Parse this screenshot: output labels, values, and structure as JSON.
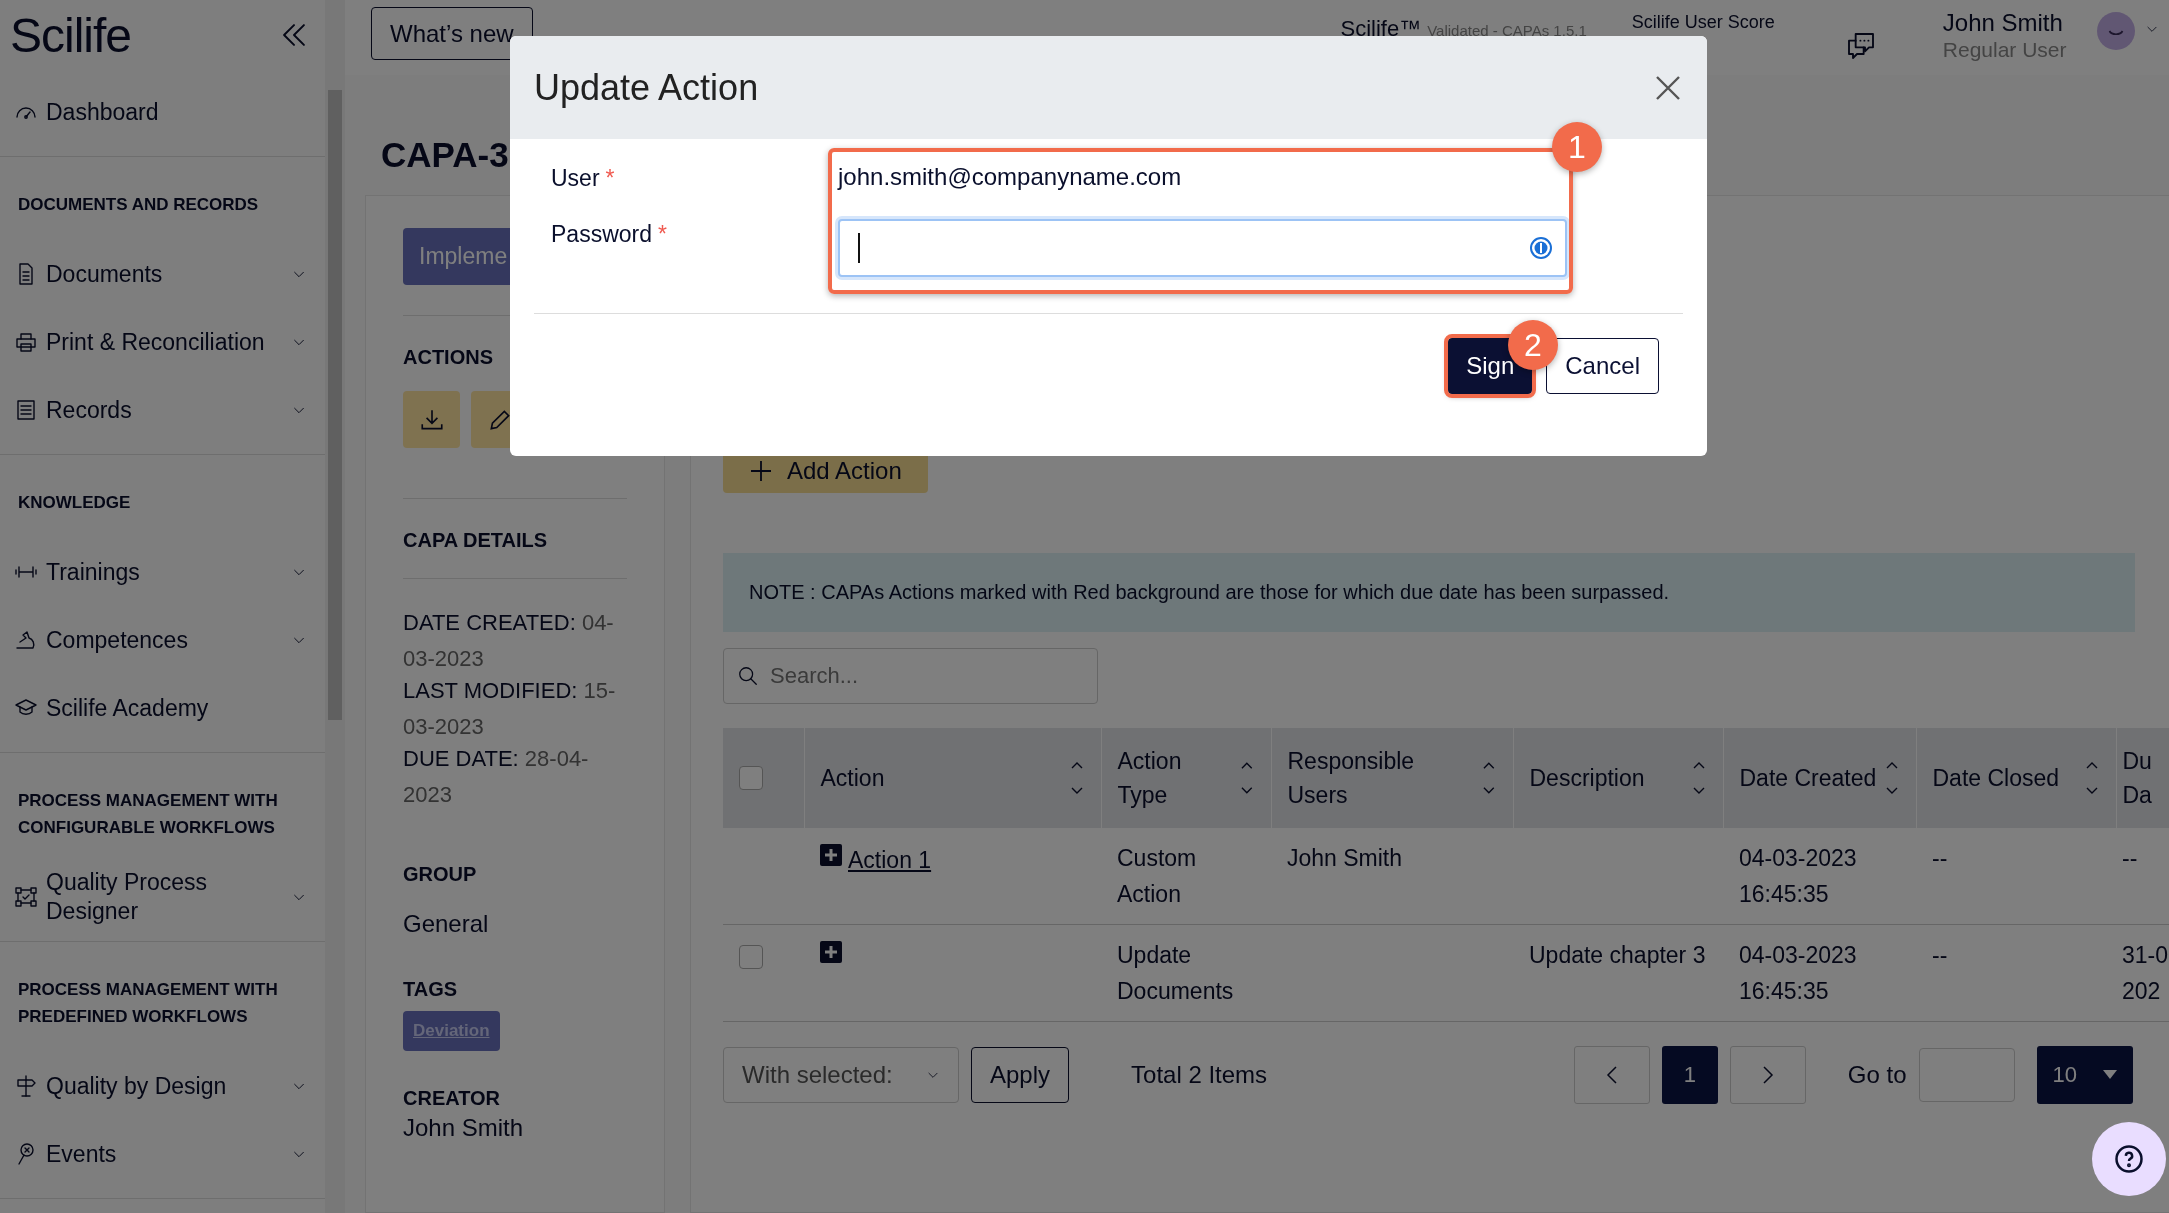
{
  "sidebar": {
    "logo": "Scilife",
    "sections": [
      {
        "items": [
          {
            "label": "Dashboard",
            "expandable": false
          }
        ]
      },
      {
        "heading": "DOCUMENTS AND RECORDS",
        "items": [
          {
            "label": "Documents",
            "expandable": true
          },
          {
            "label": "Print & Reconciliation",
            "expandable": true
          },
          {
            "label": "Records",
            "expandable": true
          }
        ]
      },
      {
        "heading": "KNOWLEDGE",
        "items": [
          {
            "label": "Trainings",
            "expandable": true
          },
          {
            "label": "Competences",
            "expandable": true
          },
          {
            "label": "Scilife Academy",
            "expandable": false
          }
        ]
      },
      {
        "heading": "PROCESS MANAGEMENT WITH CONFIGURABLE WORKFLOWS",
        "items": [
          {
            "label": "Quality Process Designer",
            "expandable": true
          }
        ]
      },
      {
        "heading": "PROCESS MANAGEMENT WITH PREDEFINED WORKFLOWS",
        "items": [
          {
            "label": "Quality by Design",
            "expandable": true
          },
          {
            "label": "Events",
            "expandable": true
          }
        ]
      }
    ]
  },
  "header": {
    "whats_new": "What’s new",
    "product": "Scilife™",
    "product_note": "Validated - CAPAs 1.5.1",
    "user_score": "Scilife User Score",
    "user": {
      "name": "John Smith",
      "role": "Regular User"
    }
  },
  "capa": {
    "title": "CAPA-3",
    "status": "Impleme",
    "actions_heading": "ACTIONS",
    "details_heading": "CAPA DETAILS",
    "details": [
      {
        "label": "DATE CREATED:",
        "value": "04-03-2023"
      },
      {
        "label": "LAST MODIFIED:",
        "value": "15-03-2023"
      },
      {
        "label": "DUE DATE:",
        "value": "28-04-2023"
      }
    ],
    "group_heading": "GROUP",
    "group": "General",
    "tags_heading": "TAGS",
    "tags": [
      "Deviation"
    ],
    "creator_heading": "CREATOR",
    "creator": "John Smith"
  },
  "actions_panel": {
    "add_button": "Add Action",
    "note": "NOTE : CAPAs Actions marked with Red background are those for which due date has been surpassed.",
    "search": {
      "placeholder": "Search..."
    },
    "table": {
      "header_checked": false,
      "columns": [
        "Action",
        "Action Type",
        "Responsible Users",
        "Description",
        "Date Created",
        "Date Closed",
        "Du Da"
      ],
      "rows": [
        {
          "action": "Action 1",
          "action_type": "Custom Action",
          "responsible_users": "John Smith",
          "description": "",
          "date_created": "04-03-2023 16:45:35",
          "date_closed": "--",
          "column_8": "--"
        },
        {
          "checked": false,
          "action": "",
          "action_type": "Update Documents",
          "responsible_users": "",
          "description": "Update chapter 3",
          "date_created": "04-03-2023 16:45:35",
          "date_closed": "--",
          "column_8": "31-0 202"
        }
      ]
    },
    "footer": {
      "bulk_select": "With selected:",
      "apply": "Apply",
      "total": "Total 2 Items",
      "pages": [
        {
          "label": "1",
          "selected": true
        }
      ],
      "goto_label": "Go to",
      "page_size": "10"
    }
  },
  "dialog": {
    "title": "Update Action",
    "fields": [
      {
        "label": "User",
        "required_mark": "*",
        "kind": "text",
        "value": "john.smith@companyname.com"
      },
      {
        "label": "Password",
        "required_mark": "*",
        "kind": "input",
        "focused": true
      }
    ],
    "buttons": [
      {
        "label": "Sign",
        "primary": true
      },
      {
        "label": "Cancel",
        "primary": false
      }
    ],
    "annotations": [
      "1",
      "2"
    ]
  }
}
